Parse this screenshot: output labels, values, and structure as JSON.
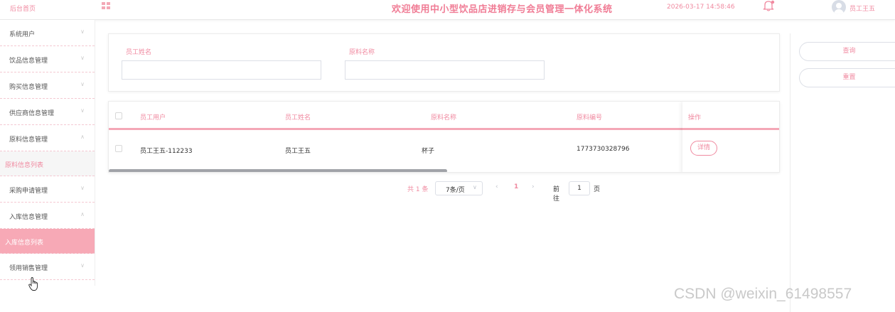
{
  "colors": {
    "accent": "#f08aa0",
    "active_bg": "#f7a9b6",
    "divider": "#f4a7b6"
  },
  "header": {
    "brand": "后台首页",
    "title": "欢迎使用中小型饮品店进销存与会员管理一体化系统",
    "datetime": "2026-03-17 14:58:46",
    "user": "员工王五"
  },
  "sidebar": {
    "items": [
      {
        "label": "系统用户",
        "chevron": "∨"
      },
      {
        "label": "饮品信息管理",
        "chevron": "∨"
      },
      {
        "label": "购买信息管理",
        "chevron": "∨"
      },
      {
        "label": "供应商信息管理",
        "chevron": "∨"
      },
      {
        "label": "原料信息管理",
        "chevron": "∧"
      },
      {
        "label": "原料信息列表",
        "sub": true
      },
      {
        "label": "采购申请管理",
        "chevron": "∨"
      },
      {
        "label": "入库信息管理",
        "chevron": "∧"
      },
      {
        "label": "入库信息列表",
        "sub": true,
        "active": true
      },
      {
        "label": "领用销售管理",
        "chevron": "∨"
      }
    ]
  },
  "search": {
    "employee_name_label": "员工姓名",
    "material_name_label": "原料名称",
    "employee_name_value": "",
    "material_name_value": ""
  },
  "actions": {
    "query": "查询",
    "reset": "重置"
  },
  "table": {
    "columns": [
      "员工用户",
      "员工姓名",
      "原料名称",
      "原料编号",
      "操作"
    ],
    "rows": [
      {
        "employee_user": "员工王五-112233",
        "employee_name": "员工王五",
        "material_name": "杯子",
        "material_code": "1773730328796",
        "action": "详情"
      }
    ]
  },
  "pagination": {
    "total": "共 1 条",
    "page_size": "7条/页",
    "current_page": "1",
    "goto_label": "前往",
    "goto_value": "1",
    "page_suffix": "页"
  },
  "watermark": "CSDN @weixin_61498557",
  "icons": {
    "apps": "grid-icon",
    "bell": "bell-icon",
    "avatar": "avatar-icon",
    "cursor": "hand-cursor-icon"
  }
}
